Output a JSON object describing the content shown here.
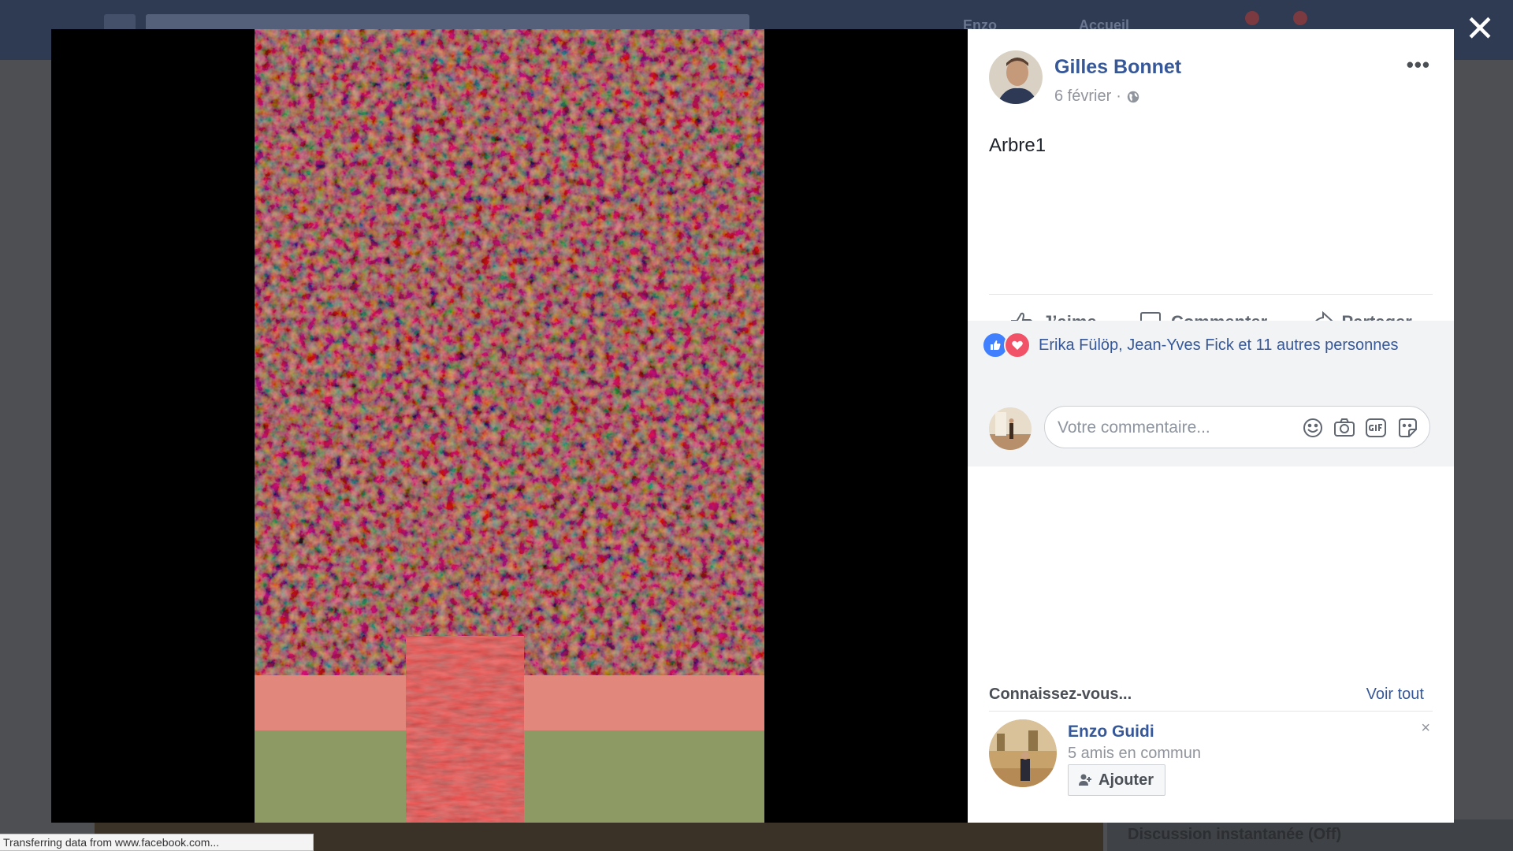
{
  "background": {
    "nav": [
      "Enzo",
      "Accueil"
    ],
    "chat_bar": "Discussion instantanée (Off)"
  },
  "lightbox": {
    "close_label": "✕",
    "photo_icon": "tree-photo",
    "post": {
      "author": "Gilles Bonnet",
      "date": "6 février",
      "separator": "·",
      "privacy_icon": "globe-icon",
      "more_label": "•••",
      "text": "Arbre1"
    },
    "actions": {
      "like": "J’aime",
      "comment": "Commenter",
      "share": "Partager"
    },
    "reactions": {
      "names": "Erika Fülöp, Jean-Yves Fick et 11 autres personnes",
      "icons": [
        "like-icon",
        "love-icon"
      ]
    },
    "comment": {
      "placeholder": "Votre commentaire...",
      "icons": [
        "emoji-icon",
        "camera-icon",
        "gif-icon",
        "sticker-icon"
      ]
    },
    "pymk": {
      "title": "Connaissez-vous...",
      "see_all": "Voir tout",
      "person": {
        "name": "Enzo Guidi",
        "mutual": "5 amis en commun",
        "add_label": "Ajouter"
      },
      "dismiss": "×"
    }
  },
  "status_bar": "Transferring data from www.facebook.com..."
}
